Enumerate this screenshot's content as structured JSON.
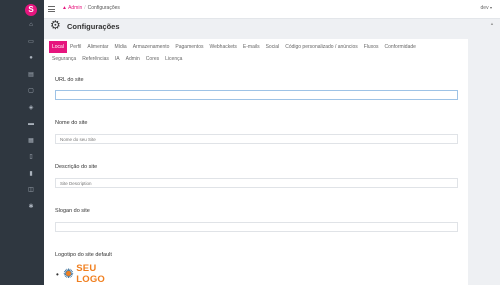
{
  "app": {
    "logo_glyph": "S",
    "brand_color": "#e6157e"
  },
  "sidebar": {
    "icons": [
      "dashboard-icon",
      "posts-icon",
      "users-icon",
      "media-icon",
      "pages-icon",
      "comments-icon",
      "appearance-icon",
      "plugins-icon",
      "tools-icon",
      "settings-icon",
      "reports-icon",
      "help-icon"
    ]
  },
  "topbar": {
    "breadcrumb_home": "Admin",
    "breadcrumb_current": "Configurações",
    "user_label": "dev"
  },
  "page": {
    "title": "Configurações"
  },
  "tabs": {
    "row1": [
      "Local",
      "Perfil",
      "Alimentar",
      "Mídia",
      "Armazenamento",
      "Pagamentos",
      "Webhackets",
      "E-mails",
      "Social",
      "Código personalizado / anúncios",
      "Fluxos",
      "Conformidade"
    ],
    "row2": [
      "Segurança",
      "Referências",
      "IA",
      "Admin",
      "Cores",
      "Licença"
    ],
    "active": "Local"
  },
  "fields": {
    "url_label": "URL do site",
    "url_value": "",
    "name_label": "Nome do site",
    "name_placeholder": "Nome do seu Site",
    "desc_label": "Descrição do site",
    "desc_placeholder": "Site Description",
    "slogan_label": "Slogan do site",
    "slogan_value": "",
    "logo_label": "Logotipo do site default"
  },
  "logo": {
    "text": "SEU LOGO",
    "text_color": "#f07f1f",
    "sun_color": "#1f5a8a"
  }
}
